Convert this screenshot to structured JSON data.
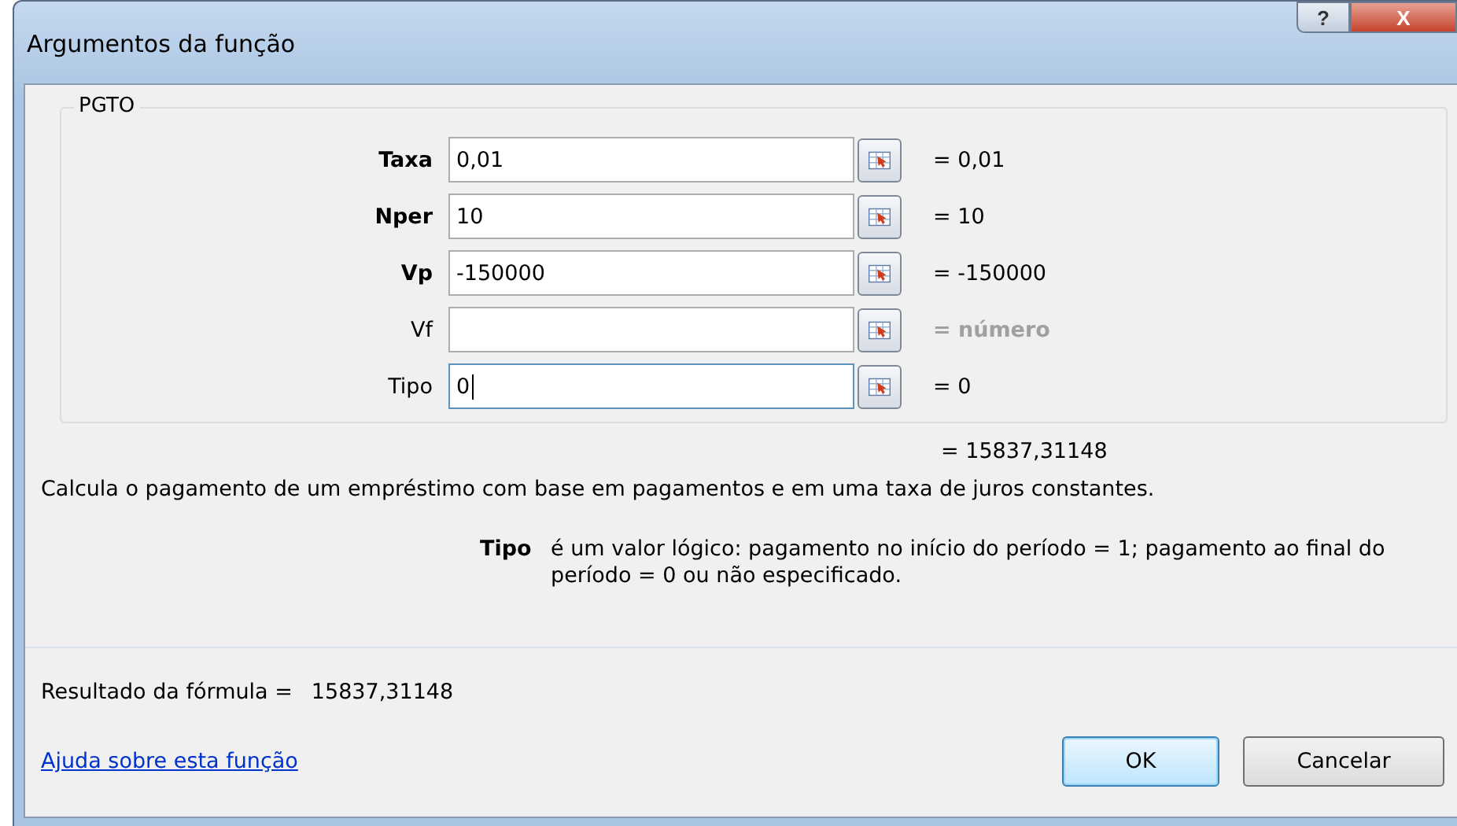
{
  "window": {
    "title": "Argumentos da função",
    "help_button": "?",
    "close_button": "X"
  },
  "function_name": "PGTO",
  "arguments": [
    {
      "label": "Taxa",
      "required": true,
      "value": "0,01",
      "result": "= 0,01",
      "result_greyed": false,
      "focused": false
    },
    {
      "label": "Nper",
      "required": true,
      "value": "10",
      "result": "= 10",
      "result_greyed": false,
      "focused": false
    },
    {
      "label": "Vp",
      "required": true,
      "value": "-150000",
      "result": "= -150000",
      "result_greyed": false,
      "focused": false
    },
    {
      "label": "Vf",
      "required": false,
      "result": "= número",
      "result_greyed": true,
      "focused": false
    },
    {
      "label": "Tipo",
      "required": false,
      "value": "0",
      "result": "= 0",
      "result_greyed": false,
      "focused": true
    }
  ],
  "function_result": "= 15837,31148",
  "description": "Calcula o pagamento de um empréstimo com base em pagamentos e em uma taxa de juros constantes.",
  "argument_help": {
    "name": "Tipo",
    "text": "é um valor lógico: pagamento no início do período = 1; pagamento ao final do período = 0 ou não especificado."
  },
  "formula_result": {
    "label": "Resultado da fórmula =",
    "value": "15837,31148"
  },
  "help_link": "Ajuda sobre esta função",
  "buttons": [
    {
      "label": "OK",
      "default": true
    },
    {
      "label": "Cancelar",
      "default": false
    }
  ]
}
